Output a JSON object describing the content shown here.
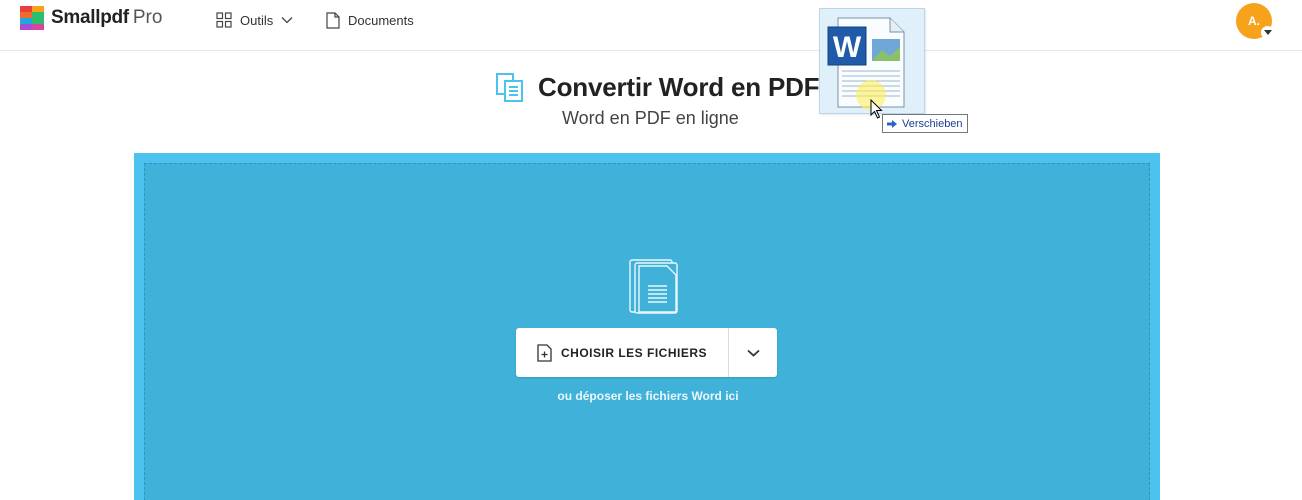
{
  "header": {
    "logo": {
      "name": "Smallpdf",
      "tier": "Pro",
      "icon": "smallpdf-logo-icon"
    },
    "nav": [
      {
        "label": "Outils",
        "icon": "grid-icon",
        "has_dropdown": true
      },
      {
        "label": "Documents",
        "icon": "document-icon"
      }
    ],
    "avatar": {
      "initials": "A.",
      "color": "#f7a21b"
    }
  },
  "main": {
    "title": "Convertir Word en PDF",
    "subtitle": "Word en PDF en ligne",
    "dropzone": {
      "button_label": "CHOISIR LES FICHIERS",
      "hint": "ou déposer les fichiers Word ici",
      "colors": {
        "outer": "#4cc3ee",
        "inner": "#40b2d9"
      }
    }
  },
  "drag_overlay": {
    "file_icon": "word-document-icon",
    "tooltip_label": "Verschieben"
  }
}
